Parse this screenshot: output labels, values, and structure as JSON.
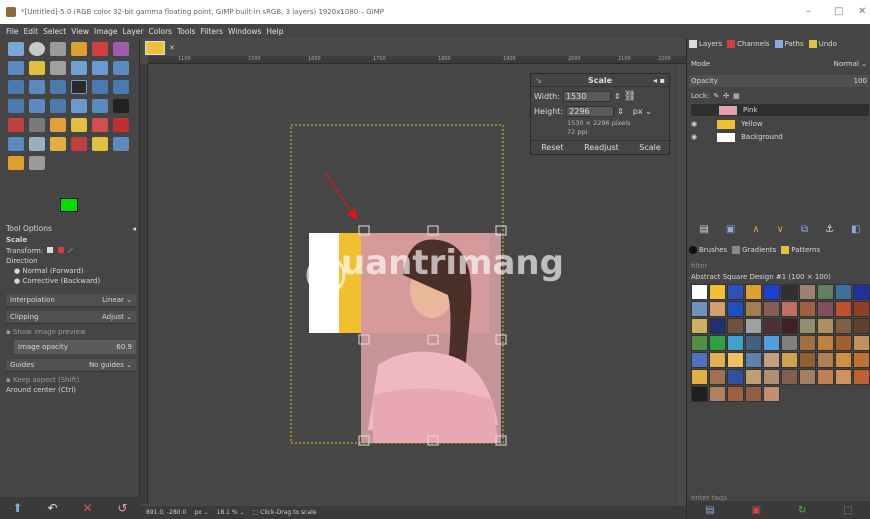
{
  "title": "*[Untitled]-5.0 (RGB color 32-bit gamma floating point, GIMP built-in sRGB, 3 layers) 1920x1080 – GIMP",
  "window_controls": [
    "–",
    "□",
    "✕"
  ],
  "menu": [
    "File",
    "Edit",
    "Select",
    "View",
    "Image",
    "Layer",
    "Colors",
    "Tools",
    "Filters",
    "Windows",
    "Help"
  ],
  "tool_options": {
    "header": "Tool Options",
    "scale_label": "Scale",
    "transform_label": "Transform:",
    "direction_label": "Direction",
    "direction_options": [
      "Normal (Forward)",
      "Corrective (Backward)"
    ],
    "interpolation_label": "Interpolation",
    "interpolation_value": "Linear",
    "clipping_label": "Clipping",
    "clipping_value": "Adjust",
    "show_preview": "Show image preview",
    "image_opacity_label": "Image opacity",
    "image_opacity_value": "60.9",
    "guides_label": "Guides",
    "guides_value": "No guides",
    "keep_aspect": "Keep aspect (Shift)",
    "around_center": "Around center (Ctrl)"
  },
  "ruler_ticks": [
    "1100",
    "1500",
    "1600",
    "1700",
    "1800",
    "1900",
    "2000",
    "2100",
    "2200"
  ],
  "statusbar": {
    "coords": "891.0, -280.0",
    "unit": "px",
    "zoom": "18.1 %",
    "hint": "Click-Drag to scale"
  },
  "scale_dialog": {
    "title": "Scale",
    "width_label": "Width:",
    "width_value": "1530",
    "height_label": "Height:",
    "height_value": "2296",
    "unit": "px",
    "size_info": "1530 × 2296 pixels",
    "ppi": "72 ppi",
    "buttons": [
      "Reset",
      "Readjust",
      "Scale"
    ]
  },
  "watermark": "uantrimang",
  "right_panel": {
    "tabs": [
      "Layers",
      "Channels",
      "Paths",
      "Undo"
    ],
    "mode_label": "Mode",
    "mode_value": "Normal",
    "opacity_label": "Opacity",
    "opacity_value": "100",
    "lock_label": "Lock:",
    "layers": [
      "Pink",
      "Yellow",
      "Background"
    ],
    "brush_tabs": [
      "Brushes",
      "Gradients",
      "Patterns"
    ],
    "filter_placeholder": "filter",
    "pattern_name": "Abstract Square Design #1 (100 × 100)",
    "tag_placeholder": "enter tags"
  },
  "colors": {
    "fg": "#00e000",
    "bg": "#ffffff",
    "yellow": "#f0c030",
    "pink": "#e9a3a8"
  }
}
